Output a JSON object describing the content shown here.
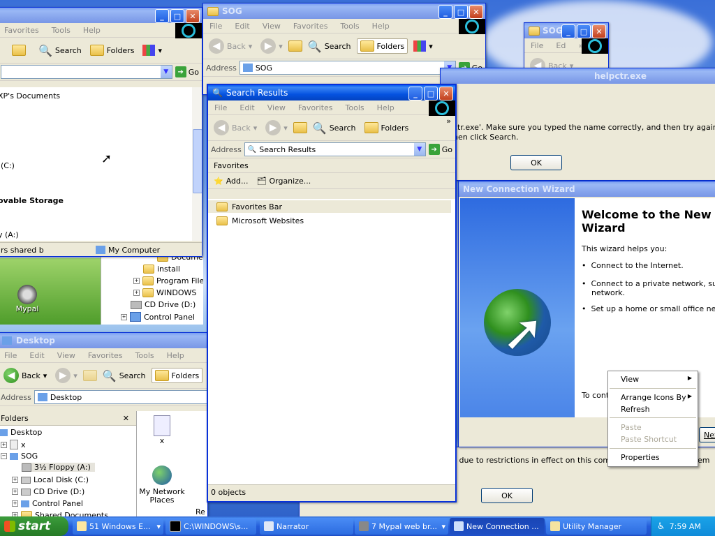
{
  "explorer_bg": {
    "menus": [
      "Favorites",
      "Tools",
      "Help"
    ],
    "toolbar": {
      "search": "Search",
      "folders": "Folders"
    },
    "go": "Go",
    "rows": [
      "XP's Documents",
      "(C:)",
      "ovable Storage",
      "y (A:)"
    ],
    "status": [
      "rs shared b",
      "My Computer"
    ]
  },
  "sog_main": {
    "title": "SOG",
    "menus": [
      "File",
      "Edit",
      "View",
      "Favorites",
      "Tools",
      "Help"
    ],
    "toolbar": {
      "back": "Back",
      "search": "Search",
      "folders": "Folders"
    },
    "address_label": "Address",
    "address_value": "SOG",
    "go": "Go"
  },
  "sog_small": {
    "title": "SOG",
    "menus": [
      "File",
      "Ed"
    ],
    "toolbar": {
      "back": "Back"
    }
  },
  "search_results": {
    "title": "Search Results",
    "menus": [
      "File",
      "Edit",
      "View",
      "Favorites",
      "Tools",
      "Help"
    ],
    "toolbar": {
      "back": "Back",
      "search": "Search",
      "folders": "Folders"
    },
    "address_label": "Address",
    "address_value": "Search Results",
    "go": "Go",
    "pane_title": "Favorites",
    "add": "Add...",
    "organize": "Organize...",
    "items": [
      "Favorites Bar",
      "Microsoft Websites"
    ],
    "status": "0 objects"
  },
  "helpctr": {
    "title": "helpctr.exe",
    "message_line1": "ctr.exe'. Make sure you typed the name correctly, and then try again. To search f",
    "message_line2": "hen click Search.",
    "ok": "OK"
  },
  "wizard": {
    "title": "New Connection Wizard",
    "heading_line1": "Welcome to the New C",
    "heading_line2": "Wizard",
    "intro": "This wizard helps you:",
    "bullets": [
      "Connect to the Internet.",
      "Connect to a private network, such as",
      "network.",
      "Set up a home or small office network"
    ],
    "footer": "To conti",
    "next": "Nex",
    "restrict": "d due to restrictions in effect on this computer",
    "restrict_tail": "em",
    "ok": "OK"
  },
  "folder_tree_bg": {
    "items": [
      "Documents",
      "install",
      "Program Files",
      "WINDOWS",
      "CD Drive (D:)",
      "Control Panel"
    ],
    "desktop_icon": "Mypal"
  },
  "desktop_win": {
    "title": "Desktop",
    "menus": [
      "File",
      "Edit",
      "View",
      "Favorites",
      "Tools",
      "Help"
    ],
    "toolbar": {
      "back": "Back",
      "search": "Search",
      "folders": "Folders"
    },
    "address_label": "Address",
    "address_value": "Desktop",
    "folders_label": "Folders",
    "tree": [
      "Desktop",
      "x",
      "SOG",
      "3½ Floppy (A:)",
      "Local Disk (C:)",
      "CD Drive (D:)",
      "Control Panel",
      "Shared Documents"
    ],
    "icons": [
      "x",
      "My Network Places",
      "Re"
    ]
  },
  "context_menu": {
    "items": [
      "View",
      "Arrange Icons By",
      "Refresh",
      "Paste",
      "Paste Shortcut",
      "Properties"
    ]
  },
  "taskbar": {
    "start": "start",
    "tasks": [
      "51 Windows E...",
      "C:\\WINDOWS\\s...",
      "Narrator",
      "7 Mypal web br...",
      "New Connection ...",
      "Utility Manager"
    ],
    "clock": "7:59 AM"
  }
}
